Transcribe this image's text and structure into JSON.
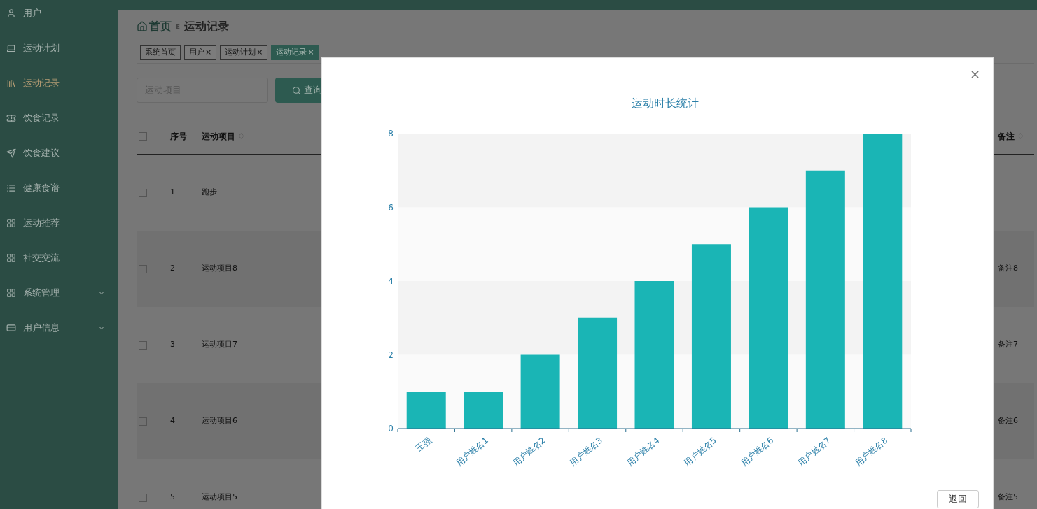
{
  "sidebar": {
    "items": [
      {
        "label": "用户",
        "kind": "link",
        "selected": false
      },
      {
        "label": "运动计划",
        "kind": "link",
        "selected": false
      },
      {
        "label": "运动记录",
        "kind": "link",
        "selected": true
      },
      {
        "label": "饮食记录",
        "kind": "link",
        "selected": false
      },
      {
        "label": "饮食建议",
        "kind": "link",
        "selected": false
      },
      {
        "label": "健康食谱",
        "kind": "link",
        "selected": false
      },
      {
        "label": "运动推荐",
        "kind": "link",
        "selected": false
      },
      {
        "label": "社交交流",
        "kind": "link",
        "selected": false
      },
      {
        "label": "系统管理",
        "kind": "submenu",
        "selected": false
      },
      {
        "label": "用户信息",
        "kind": "submenu",
        "selected": false
      }
    ]
  },
  "breadcrumb": {
    "home": "首页",
    "separator": "ᴇ",
    "current": "运动记录"
  },
  "tabs": [
    {
      "label": "系统首页",
      "closable": false,
      "selected": false
    },
    {
      "label": "用户",
      "closable": true,
      "selected": false
    },
    {
      "label": "运动计划",
      "closable": true,
      "selected": false
    },
    {
      "label": "运动记录",
      "closable": true,
      "selected": true
    }
  ],
  "close_glyph": "×",
  "search": {
    "placeholder": "运动项目",
    "button": "查询"
  },
  "table": {
    "select_all_checked": false,
    "columns": [
      "序号",
      "运动项目",
      "备注"
    ],
    "rows": [
      {
        "checked": false,
        "index": "1",
        "item": "跑步",
        "note": ""
      },
      {
        "checked": false,
        "index": "2",
        "item": "运动项目8",
        "note": "备注8"
      },
      {
        "checked": false,
        "index": "3",
        "item": "运动项目7",
        "note": "备注7"
      },
      {
        "checked": false,
        "index": "4",
        "item": "运动项目6",
        "note": "备注6"
      },
      {
        "checked": false,
        "index": "5",
        "item": "运动项目5",
        "note": "备注5"
      }
    ]
  },
  "modal": {
    "close": "×",
    "button": "返回",
    "chart_data": {
      "type": "bar",
      "title": "运动时长统计",
      "categories": [
        "王强",
        "用户姓名1",
        "用户姓名2",
        "用户姓名3",
        "用户姓名4",
        "用户姓名5",
        "用户姓名6",
        "用户姓名7",
        "用户姓名8"
      ],
      "series": [
        {
          "color": "#1ab5b5",
          "values": [
            1,
            1,
            2,
            3,
            4,
            5,
            6,
            7,
            8
          ]
        }
      ],
      "ylim": [
        0,
        8
      ],
      "yticks": [
        0,
        2,
        4,
        6,
        8
      ]
    }
  }
}
